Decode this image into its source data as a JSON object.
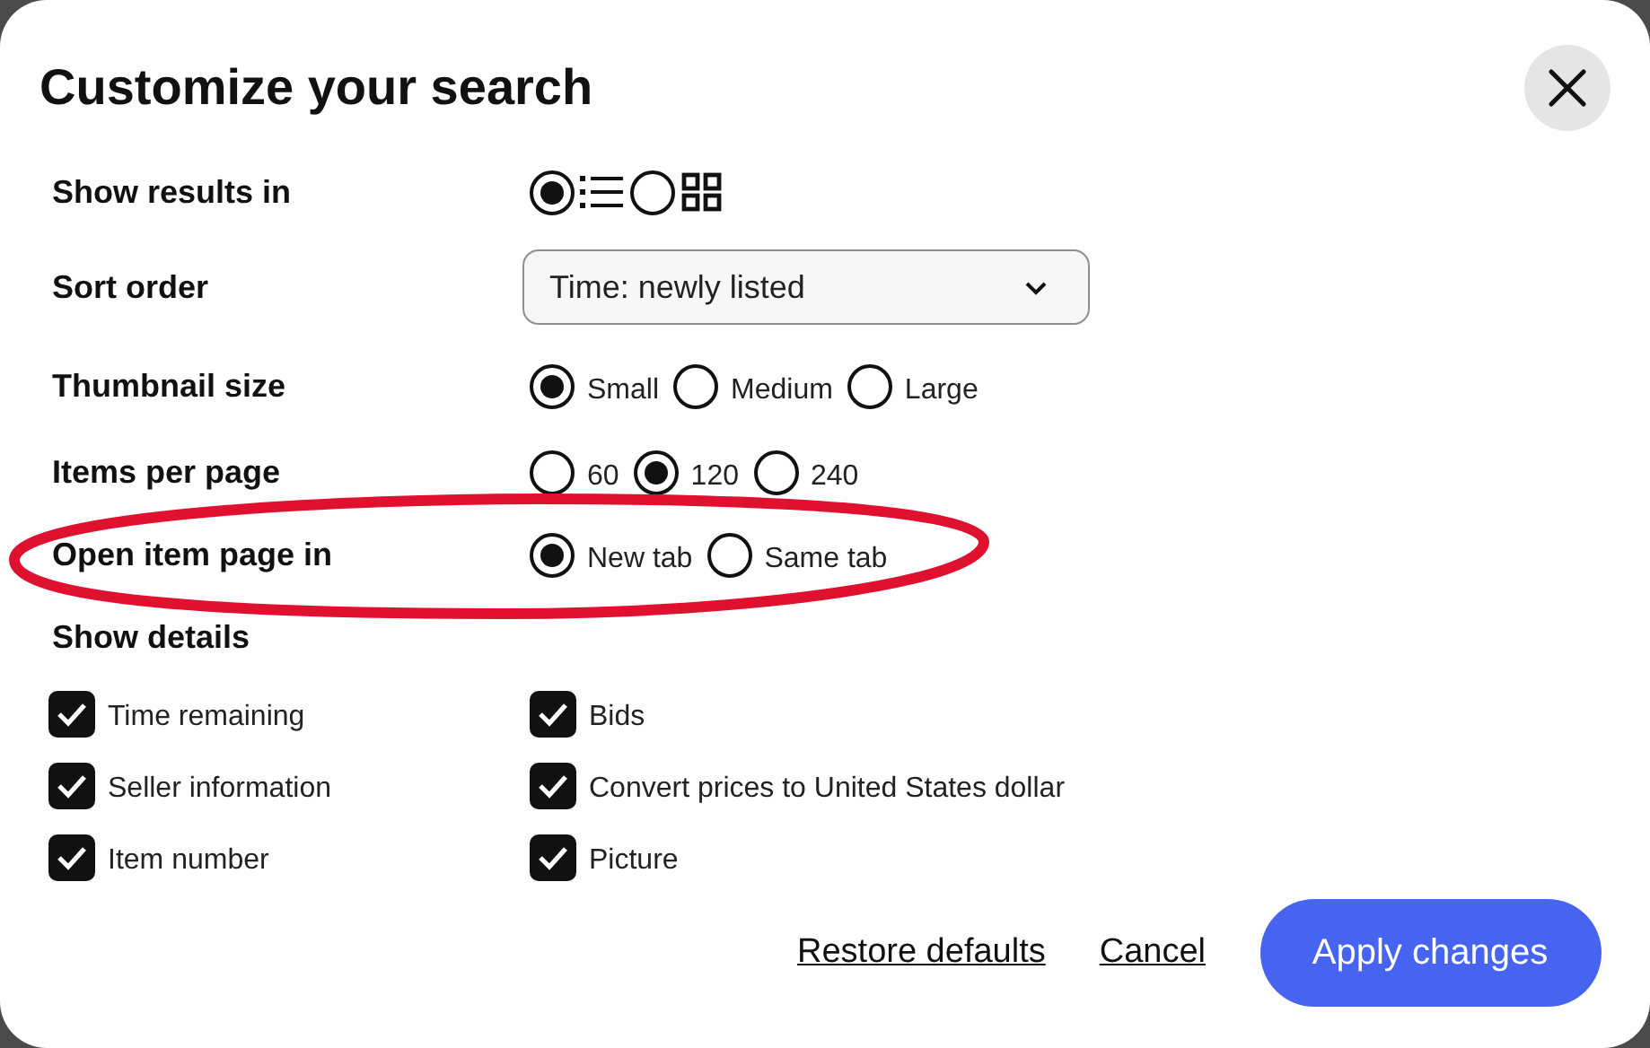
{
  "title": "Customize your search",
  "settings": [
    {
      "label": "Show results in",
      "kind": "view",
      "highlighted": false,
      "options": [
        {
          "kind": "list",
          "selected": true
        },
        {
          "kind": "grid",
          "selected": false
        }
      ]
    },
    {
      "label": "Sort order",
      "kind": "dropdown",
      "highlighted": false,
      "value": "Time: newly listed"
    },
    {
      "label": "Thumbnail size",
      "kind": "radio",
      "highlighted": false,
      "options": [
        {
          "label": "Small",
          "selected": true
        },
        {
          "label": "Medium",
          "selected": false
        },
        {
          "label": "Large",
          "selected": false
        }
      ]
    },
    {
      "label": "Items per page",
      "kind": "radio",
      "highlighted": false,
      "options": [
        {
          "label": "60",
          "selected": false
        },
        {
          "label": "120",
          "selected": true
        },
        {
          "label": "240",
          "selected": false
        }
      ]
    },
    {
      "label": "Open item page in",
      "kind": "radio",
      "highlighted": true,
      "options": [
        {
          "label": "New tab",
          "selected": true
        },
        {
          "label": "Same tab",
          "selected": false
        }
      ]
    }
  ],
  "show_details": {
    "label": "Show details",
    "items": [
      {
        "label": "Time remaining",
        "checked": true
      },
      {
        "label": "Bids",
        "checked": true
      },
      {
        "label": "Seller information",
        "checked": true
      },
      {
        "label": "Convert prices to United States dollar",
        "checked": true
      },
      {
        "label": "Item number",
        "checked": true
      },
      {
        "label": "Picture",
        "checked": true
      }
    ]
  },
  "buttons": [
    {
      "label": "Restore defaults",
      "kind": "link"
    },
    {
      "label": "Cancel",
      "kind": "link"
    },
    {
      "label": "Apply changes",
      "kind": "primary"
    }
  ]
}
